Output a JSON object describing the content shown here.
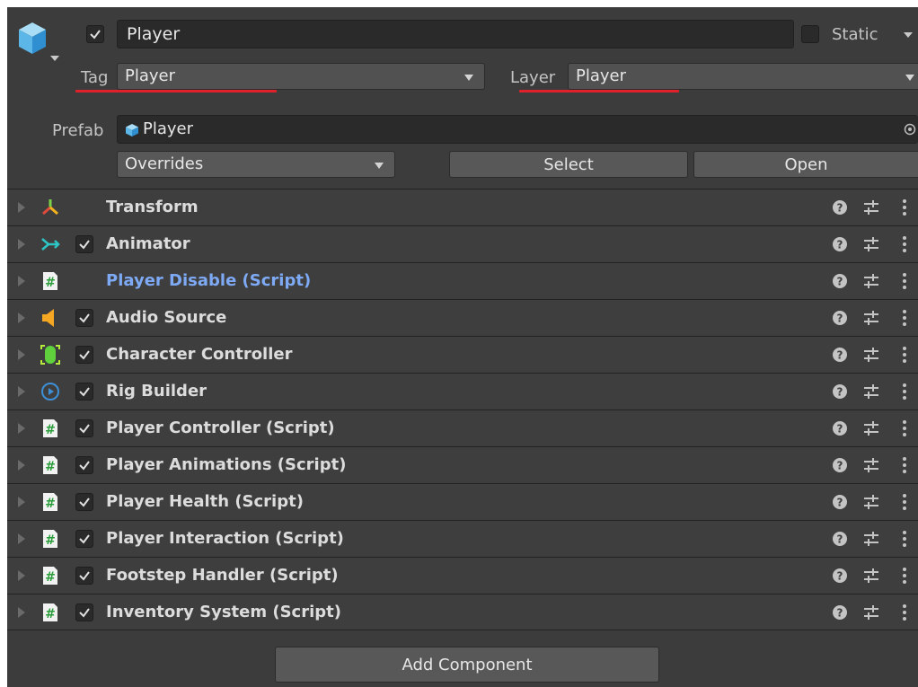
{
  "header": {
    "object_active": true,
    "name_value": "Player",
    "static_label": "Static",
    "static_checked": false,
    "tag_label": "Tag",
    "tag_value": "Player",
    "layer_label": "Layer",
    "layer_value": "Player",
    "prefab_label": "Prefab",
    "prefab_value": "Player",
    "overrides_label": "Overrides",
    "select_label": "Select",
    "open_label": "Open",
    "accent_underline_color": "#e0202a"
  },
  "components": [
    {
      "name": "Transform",
      "icon": "transform-icon",
      "has_checkbox": false,
      "checked": false,
      "style": "normal"
    },
    {
      "name": "Animator",
      "icon": "animator-icon",
      "has_checkbox": true,
      "checked": true,
      "style": "normal"
    },
    {
      "name": "Player Disable (Script)",
      "icon": "script-icon",
      "has_checkbox": false,
      "checked": false,
      "style": "blue"
    },
    {
      "name": "Audio Source",
      "icon": "audio-source-icon",
      "has_checkbox": true,
      "checked": true,
      "style": "normal"
    },
    {
      "name": "Character Controller",
      "icon": "character-controller-icon",
      "has_checkbox": true,
      "checked": true,
      "style": "normal"
    },
    {
      "name": "Rig Builder",
      "icon": "rig-builder-icon",
      "has_checkbox": true,
      "checked": true,
      "style": "normal"
    },
    {
      "name": "Player Controller (Script)",
      "icon": "script-icon",
      "has_checkbox": true,
      "checked": true,
      "style": "normal"
    },
    {
      "name": "Player Animations (Script)",
      "icon": "script-icon",
      "has_checkbox": true,
      "checked": true,
      "style": "normal"
    },
    {
      "name": "Player Health (Script)",
      "icon": "script-icon",
      "has_checkbox": true,
      "checked": true,
      "style": "normal"
    },
    {
      "name": "Player Interaction (Script)",
      "icon": "script-icon",
      "has_checkbox": true,
      "checked": true,
      "style": "normal"
    },
    {
      "name": "Footstep Handler (Script)",
      "icon": "script-icon",
      "has_checkbox": true,
      "checked": true,
      "style": "normal"
    },
    {
      "name": "Inventory System (Script)",
      "icon": "script-icon",
      "has_checkbox": true,
      "checked": true,
      "style": "normal"
    }
  ],
  "footer": {
    "add_component_label": "Add Component"
  }
}
